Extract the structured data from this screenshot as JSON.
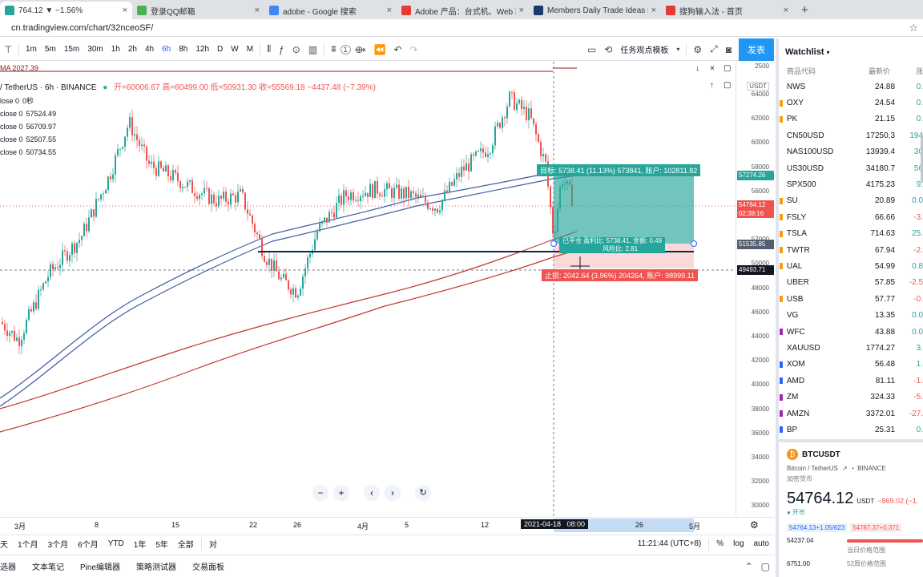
{
  "browser": {
    "tabs": [
      {
        "title": "764.12 ▼ −1.56%",
        "color": "#26a69a"
      },
      {
        "title": "登录QQ邮箱",
        "color": "#4caf50"
      },
      {
        "title": "adobe - Google 搜索",
        "color": "#4285f4"
      },
      {
        "title": "Adobe 产品：台式机、Web 和移",
        "color": "#e53935"
      },
      {
        "title": "Members Daily Trade Ideas Ne",
        "color": "#1a3a6b"
      },
      {
        "title": "搜狗输入法 - 首页",
        "color": "#e53935"
      }
    ],
    "url": "cn.tradingview.com/chart/32nceoSF/"
  },
  "toolbar": {
    "intervals": [
      "1m",
      "5m",
      "15m",
      "30m",
      "1h",
      "2h",
      "4h",
      "6h",
      "8h",
      "12h",
      "D",
      "W",
      "M"
    ],
    "active_interval": "6h",
    "template_label": "任务观点模板",
    "publish_label": "发表",
    "badge": "1"
  },
  "chart": {
    "title": "/ TetherUS · 6h · BINANCE",
    "ohlc": "开=60006.67 高=60499.00 低=50931.30 收=55569.18 −4437.48 (−7.39%)",
    "ma_label": "MA 2027.39",
    "indicators": [
      {
        "label": "lose 0",
        "value": "0秒"
      },
      {
        "label": "close 0",
        "value": "57524.49"
      },
      {
        "label": "close 0",
        "value": "56709.97"
      },
      {
        "label": "close 0",
        "value": "52507.55"
      },
      {
        "label": "close 0",
        "value": "50734.55"
      }
    ],
    "price_ticks": [
      "64000",
      "62000",
      "60000",
      "58000",
      "56000",
      "54000",
      "52000",
      "50000",
      "48000",
      "46000",
      "44000",
      "42000",
      "40000",
      "38000",
      "36000",
      "34000",
      "32000",
      "30000"
    ],
    "scale_top": "2500",
    "scale_unit": "USDT",
    "current_price": "54764.12",
    "countdown": "02:38:16",
    "box_price_1": "57274.26",
    "box_price_2": "51535.85",
    "crosshair_price": "49493.71",
    "position": {
      "target_label": "目标: 5738.41 (11.13%) 573841, 账户: 102811.82",
      "entry_label": "已平仓 盈利比: 5738.41, 金额: 0.49",
      "entry_label2": "风险比: 2.81",
      "stop_label": "止损: 2042.64 (3.96%) 204264, 账户: 98999.11"
    },
    "time_ticks": [
      "3月",
      "8",
      "15",
      "22",
      "26",
      "4月",
      "5",
      "12",
      "26",
      "5月"
    ],
    "crosshair_time": "2021-04-18   08:00"
  },
  "chart_data": {
    "type": "line",
    "title": "/ TetherUS · 6h · BINANCE",
    "xlabel": "",
    "ylabel": "",
    "x": [
      "3月",
      "8",
      "15",
      "22",
      "26",
      "4月",
      "5",
      "12",
      "2021-04-18",
      "26"
    ],
    "ylim": [
      29000,
      66000
    ],
    "series": [
      {
        "name": "",
        "values": [
          45000,
          52000,
          60000,
          58000,
          51000,
          56000,
          58500,
          61000,
          56000
        ]
      }
    ],
    "grid": false,
    "legend": "none"
  },
  "range": {
    "buttons": [
      "天",
      "1个月",
      "3个月",
      "6个月",
      "YTD",
      "1年",
      "5年",
      "全部"
    ],
    "compare": "对",
    "clock": "11:21:44 (UTC+8)",
    "pct": "%",
    "log": "log",
    "auto": "auto"
  },
  "bottom": {
    "tabs": [
      "选器",
      "文本笔记",
      "Pine编辑器",
      "策略测试器",
      "交易面板"
    ]
  },
  "watchlist": {
    "title": "Watchlist",
    "cols": [
      "商品代码",
      "最新价",
      "涨"
    ],
    "rows": [
      {
        "sym": "NWS",
        "price": "24.88",
        "chg": "0.",
        "dir": "up",
        "mark": ""
      },
      {
        "sym": "OXY",
        "price": "24.54",
        "chg": "0.",
        "dir": "up",
        "mark": "#f59e0b"
      },
      {
        "sym": "PK",
        "price": "21.15",
        "chg": "0.",
        "dir": "up",
        "mark": "#f59e0b"
      },
      {
        "sym": "CN50USD",
        "price": "17250.3",
        "chg": "194",
        "dir": "up",
        "mark": ""
      },
      {
        "sym": "NAS100USD",
        "price": "13939.4",
        "chg": "30",
        "dir": "up",
        "mark": ""
      },
      {
        "sym": "US30USD",
        "price": "34180.7",
        "chg": "56",
        "dir": "up",
        "mark": ""
      },
      {
        "sym": "SPX500",
        "price": "4175.23",
        "chg": "9.",
        "dir": "up",
        "mark": ""
      },
      {
        "sym": "SU",
        "price": "20.89",
        "chg": "0.0",
        "dir": "up",
        "mark": "#f59e0b"
      },
      {
        "sym": "FSLY",
        "price": "66.66",
        "chg": "-3.",
        "dir": "down",
        "mark": "#f59e0b"
      },
      {
        "sym": "TSLA",
        "price": "714.63",
        "chg": "25.",
        "dir": "up",
        "mark": "#f59e0b"
      },
      {
        "sym": "TWTR",
        "price": "67.94",
        "chg": "-2.",
        "dir": "down",
        "mark": "#f59e0b"
      },
      {
        "sym": "UAL",
        "price": "54.99",
        "chg": "0.8",
        "dir": "up",
        "mark": "#f59e0b"
      },
      {
        "sym": "UBER",
        "price": "57.85",
        "chg": "-2.5",
        "dir": "down",
        "mark": ""
      },
      {
        "sym": "USB",
        "price": "57.77",
        "chg": "-0.",
        "dir": "down",
        "mark": "#f59e0b"
      },
      {
        "sym": "VG",
        "price": "13.35",
        "chg": "0.0",
        "dir": "up",
        "mark": ""
      },
      {
        "sym": "WFC",
        "price": "43.88",
        "chg": "0.0",
        "dir": "up",
        "mark": "#9c27b0"
      },
      {
        "sym": "XAUUSD",
        "price": "1774.27",
        "chg": "3.",
        "dir": "up",
        "mark": ""
      },
      {
        "sym": "XOM",
        "price": "56.48",
        "chg": "1.",
        "dir": "up",
        "mark": "#2962ff"
      },
      {
        "sym": "AMD",
        "price": "81.11",
        "chg": "-1.",
        "dir": "down",
        "mark": "#2962ff"
      },
      {
        "sym": "ZM",
        "price": "324.33",
        "chg": "-5.",
        "dir": "down",
        "mark": "#9c27b0"
      },
      {
        "sym": "AMZN",
        "price": "3372.01",
        "chg": "-27.",
        "dir": "down",
        "mark": "#9c27b0"
      },
      {
        "sym": "BP",
        "price": "25.31",
        "chg": "0.",
        "dir": "up",
        "mark": "#2962ff"
      }
    ]
  },
  "detail": {
    "symbol": "BTCUSDT",
    "desc": "Bitcoin / TetherUS",
    "exchange": "BINANCE",
    "category": "加密货币",
    "price": "54764.12",
    "unit": "USDT",
    "change": "−869.02 (−1.",
    "status": "开市",
    "bid": "54764.13+1.05/623",
    "ask": "54787.37+0.371",
    "low": "54237.04",
    "range_label": "当日价格范围",
    "low2": "6751.00",
    "range_label2": "52周价格范围"
  }
}
